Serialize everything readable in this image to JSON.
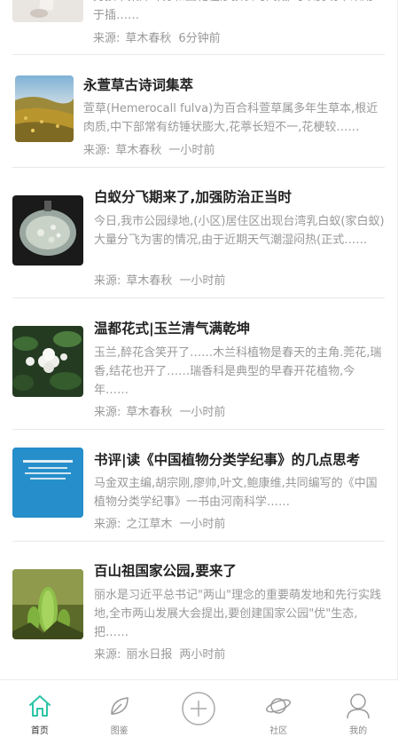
{
  "articles": [
    {
      "title": "",
      "summary": "另孩下粟沐叶苏和面花在涉孩长时间,都可以剪切下来用于插……",
      "source_label": "来源:",
      "source": "草木春秋",
      "time": "6分钟前"
    },
    {
      "title": "永萱草古诗词集萃",
      "summary": "萱草(Hemerocall fulva)为百合科萱草属多年生草本,根近肉质,中下部常有纺锤状膨大,花葶长短不一,花梗较……",
      "source_label": "来源:",
      "source": "草木春秋",
      "time": "一小时前"
    },
    {
      "title": "白蚁分飞期来了,加强防治正当时",
      "summary": "今日,我市公园绿地,(小区)居住区出现台湾乳白蚁(家白蚁)大量分飞为害的情况,由于近期天气潮湿闷热(正式……",
      "source_label": "来源:",
      "source": "草木春秋",
      "time": "一小时前"
    },
    {
      "title": "温都花式|玉兰清气满乾坤",
      "summary": "玉兰,醉花含笑开了……木兰科植物是春天的主角.莞花,瑞香,结花也开了……瑞香科是典型的早春开花植物,今年……",
      "source_label": "来源:",
      "source": "草木春秋",
      "time": "一小时前"
    },
    {
      "title": "书评|读《中国植物分类学纪事》的几点思考",
      "summary": "马金双主编,胡宗刚,廖帅,叶文,鲍康维,共同编写的《中国植物分类学纪事》一书由河南科学……",
      "source_label": "来源:",
      "source": "之江草木",
      "time": "一小时前"
    },
    {
      "title": "百山祖国家公园,要来了",
      "summary": "丽水是习近平总书记\"两山\"理念的重要萌发地和先行实践地,全市两山发展大会提出,要创建国家公园\"优\"生态,把……",
      "source_label": "来源:",
      "source": "丽水日报",
      "time": "两小时前"
    }
  ],
  "tabbar": {
    "tabs": [
      {
        "label": "首页",
        "icon": "home-icon",
        "active": true
      },
      {
        "label": "图鉴",
        "icon": "leaf-icon",
        "active": false
      },
      {
        "label": "",
        "icon": "plus-circle-icon",
        "active": false
      },
      {
        "label": "社区",
        "icon": "planet-icon",
        "active": false
      },
      {
        "label": "我的",
        "icon": "user-icon",
        "active": false
      }
    ],
    "accent": "#2ec4a6"
  }
}
